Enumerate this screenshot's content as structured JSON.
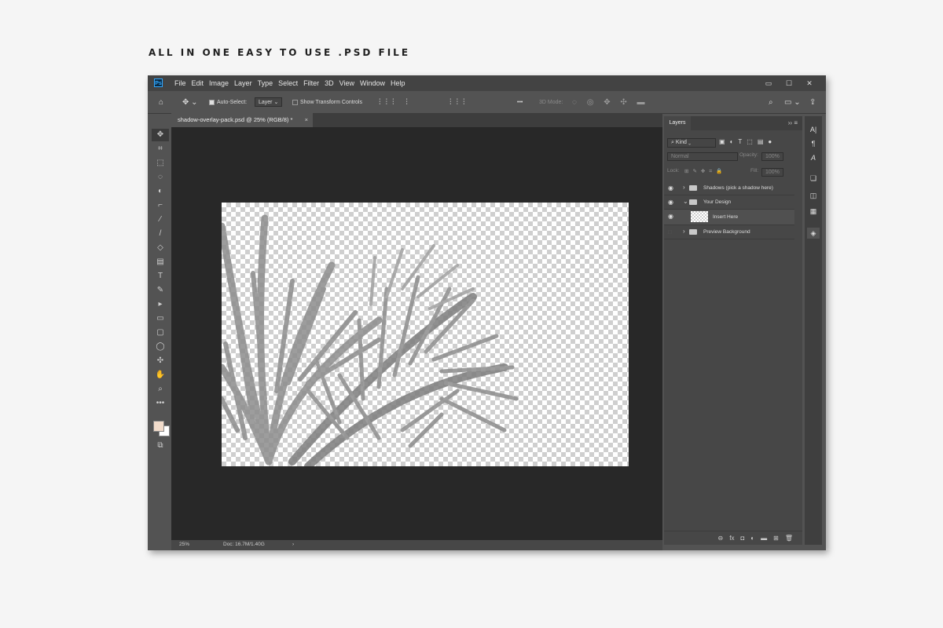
{
  "heading": "ALL IN ONE EASY TO USE .PSD FILE",
  "app": {
    "logo": "Ps",
    "menu": [
      "File",
      "Edit",
      "Image",
      "Layer",
      "Type",
      "Select",
      "Filter",
      "3D",
      "View",
      "Window",
      "Help"
    ],
    "window_controls": [
      "▭",
      "☐",
      "✕"
    ]
  },
  "options": {
    "auto_select_label": "Auto-Select:",
    "auto_select_checked": true,
    "layer_select": "Layer",
    "show_transform_label": "Show Transform Controls",
    "mode_3d_label": "3D Mode:",
    "more": "•••"
  },
  "document": {
    "tab_title": "shadow-overlay-pack.psd @ 25% (RGB/8) *",
    "close": "×",
    "zoom": "25%",
    "doc_info": "Doc: 16.7M/1.40G",
    "status_arrow": "›"
  },
  "tools": [
    "move-tool",
    "artboard-tool",
    "marquee-tool",
    "lasso-tool",
    "quick-select-tool",
    "crop-tool",
    "eyedropper-tool",
    "brush-tool",
    "eraser-tool",
    "gradient-tool",
    "type-tool",
    "pen-tool",
    "path-select-tool",
    "rectangle-tool",
    "rounded-rect-tool",
    "ellipse-tool",
    "custom-shape-tool",
    "hand-tool",
    "zoom-tool",
    "more-tools"
  ],
  "tool_glyphs": [
    "✥",
    "⌗",
    "⬚",
    "◌",
    "◐",
    "⌐",
    "⁄",
    "/",
    "◇",
    "▤",
    "T",
    "✎",
    "▸",
    "▭",
    "▢",
    "◯",
    "✣",
    "✋",
    "⌕",
    "•••"
  ],
  "colors": {
    "foreground": "#f2dccb",
    "background": "#ffffff",
    "accent": "#31a8ff"
  },
  "layers_panel": {
    "tab_label": "Layers",
    "collapse": "››",
    "menu": "≡",
    "kind_label": "Kind",
    "blend_mode": "Normal",
    "opacity_label": "Opacity:",
    "opacity_value": "100%",
    "lock_label": "Lock:",
    "fill_label": "Fill:",
    "fill_value": "100%",
    "layers": [
      {
        "name": "Shadows (pick a shadow here)",
        "type": "group",
        "visible": true,
        "expanded": false
      },
      {
        "name": "Your Design",
        "type": "group",
        "visible": true,
        "expanded": true
      },
      {
        "name": "Insert Here",
        "type": "layer",
        "visible": true,
        "selected": true
      },
      {
        "name": "Preview Background",
        "type": "group",
        "visible": false,
        "expanded": false
      }
    ],
    "footer_icons": [
      "link-icon",
      "fx-icon",
      "mask-icon",
      "adjustment-icon",
      "folder-icon",
      "new-layer-icon",
      "trash-icon"
    ],
    "footer_glyphs": [
      "⊖",
      "fx",
      "◘",
      "◐",
      "▬",
      "⊞",
      "🗑"
    ]
  },
  "right_strip": {
    "icons": [
      "character-icon",
      "paragraph-icon",
      "glyphs-icon",
      "libraries-icon",
      "properties-icon",
      "adjustments-icon",
      "layers-icon"
    ],
    "glyphs": [
      "A|",
      "¶",
      "A",
      "❏",
      "◫",
      "▦",
      "◈"
    ]
  }
}
